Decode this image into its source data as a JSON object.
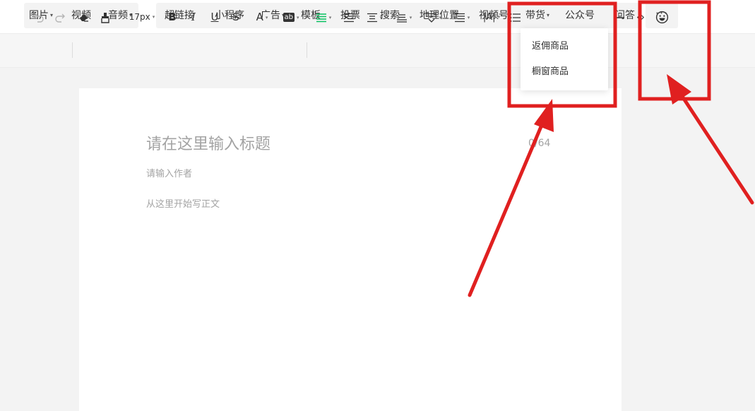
{
  "menu": {
    "group1": [
      {
        "label": "图片",
        "has_caret": true
      },
      {
        "label": "视频",
        "has_caret": false
      },
      {
        "label": "音频",
        "has_caret": true
      }
    ],
    "items": [
      {
        "label": "超链接"
      },
      {
        "label": "小程序"
      },
      {
        "label": "广告",
        "has_caret": true
      },
      {
        "label": "模板"
      },
      {
        "label": "投票"
      },
      {
        "label": "搜索"
      },
      {
        "label": "地理位置"
      },
      {
        "label": "视频号"
      },
      {
        "label": "带货",
        "has_caret": true
      },
      {
        "label": "公众号"
      },
      {
        "label": "问答"
      }
    ],
    "more_label": "···",
    "caret": "▾"
  },
  "toolbar": {
    "font_size": "17px",
    "bold": "B",
    "italic": "I",
    "underline": "U",
    "strike": "S",
    "font_color": "A",
    "bg_color": "ab",
    "letter_spacing": "|A|",
    "code_view": "‹›",
    "accent_color": "#07c160"
  },
  "dropdown": {
    "items": [
      "返佣商品",
      "橱窗商品"
    ]
  },
  "editor": {
    "title_placeholder": "请在这里输入标题",
    "title_count": "0/64",
    "author_placeholder": "请输入作者",
    "body_placeholder": "从这里开始写正文"
  },
  "annotation_color": "#e02020"
}
